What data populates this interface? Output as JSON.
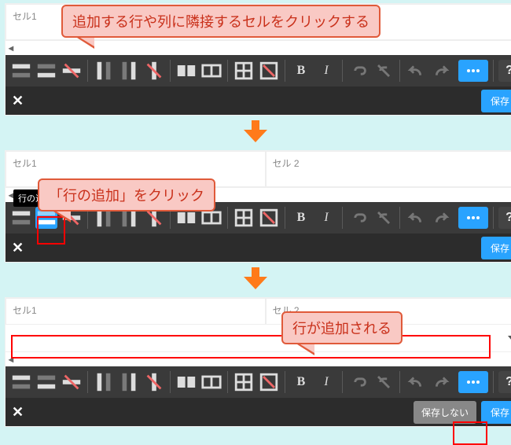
{
  "callouts": {
    "step1": "追加する行や列に隣接するセルをクリックする",
    "step2": "「行の追加」をクリック",
    "step3": "行が追加される"
  },
  "tooltip_add_row": "行の追",
  "cells": {
    "c1": "セル1",
    "c2": "セル 2"
  },
  "buttons": {
    "save": "保存",
    "nosave": "保存しない",
    "help": "?",
    "more": "•••"
  },
  "toolbar": {
    "row_before": "row-insert-before",
    "row_after": "row-insert-after",
    "row_delete": "row-delete",
    "col_before": "col-insert-before",
    "col_after": "col-insert-after",
    "col_delete": "col-delete",
    "merge": "merge-cells",
    "split": "split-cells",
    "table_insert": "table-insert",
    "table_delete": "table-delete",
    "bold": "B",
    "italic": "I",
    "link": "link",
    "unlink": "unlink",
    "undo": "undo",
    "redo": "redo"
  },
  "side": {
    "collapse": "collapse-icon",
    "expand": "expand-icon",
    "trash": "trash-icon",
    "copy": "copy-icon"
  }
}
